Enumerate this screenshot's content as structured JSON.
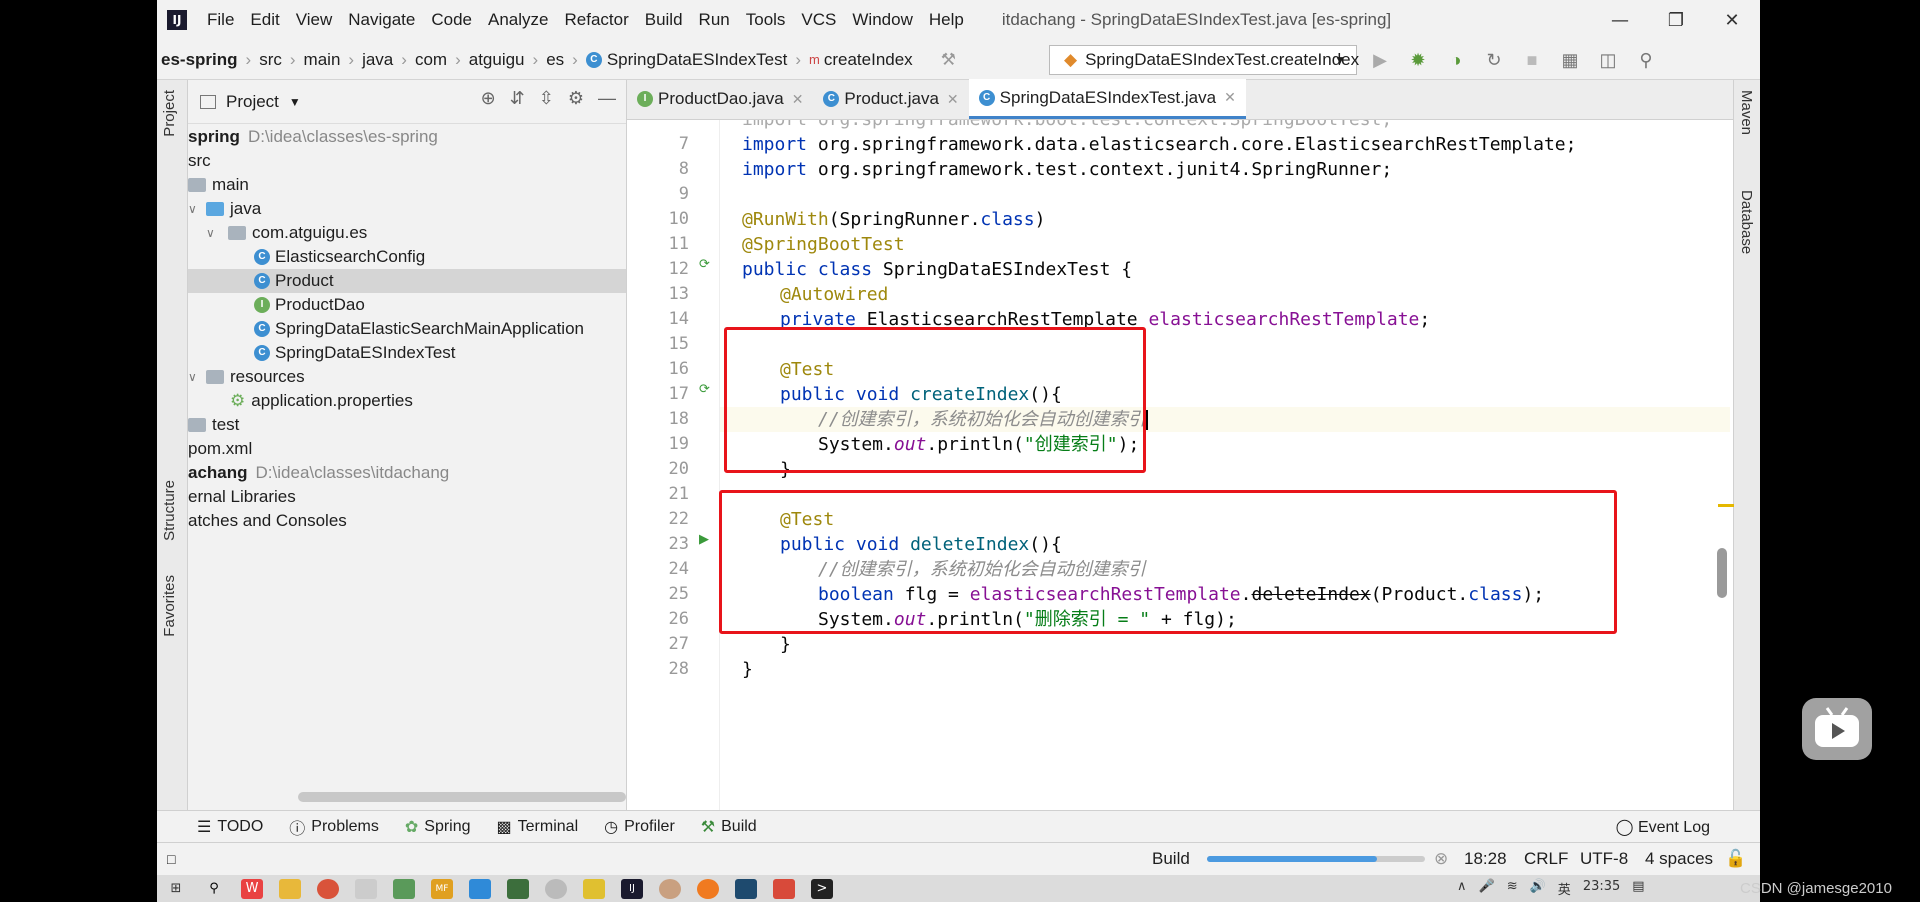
{
  "window": {
    "title": "itdachang - SpringDataESIndexTest.java [es-spring]"
  },
  "menu": [
    "File",
    "Edit",
    "View",
    "Navigate",
    "Code",
    "Analyze",
    "Refactor",
    "Build",
    "Run",
    "Tools",
    "VCS",
    "Window",
    "Help"
  ],
  "breadcrumb": [
    "es-spring",
    "src",
    "main",
    "java",
    "com",
    "atguigu",
    "es",
    "SpringDataESIndexTest",
    "createIndex"
  ],
  "run_config": "SpringDataESIndexTest.createIndex",
  "left_strip": {
    "project": "Project",
    "structure": "Structure",
    "favorites": "Favorites"
  },
  "right_strip": {
    "maven": "Maven",
    "database": "Database"
  },
  "project_panel": {
    "title": "Project",
    "tree": [
      {
        "label": "spring",
        "path": "D:\\idea\\classes\\es-spring"
      },
      {
        "label": "src"
      },
      {
        "label": "main"
      },
      {
        "label": "java"
      },
      {
        "label": "com.atguigu.es"
      },
      {
        "label": "ElasticsearchConfig"
      },
      {
        "label": "Product"
      },
      {
        "label": "ProductDao"
      },
      {
        "label": "SpringDataElasticSearchMainApplication"
      },
      {
        "label": "SpringDataESIndexTest"
      },
      {
        "label": "resources"
      },
      {
        "label": "application.properties"
      },
      {
        "label": "test"
      },
      {
        "label": "pom.xml"
      },
      {
        "label": "achang",
        "path": "D:\\idea\\classes\\itdachang"
      },
      {
        "label": "ernal Libraries"
      },
      {
        "label": "atches and Consoles"
      }
    ]
  },
  "tabs": [
    "ProductDao.java",
    "Product.java",
    "SpringDataESIndexTest.java"
  ],
  "line_numbers": [
    "7",
    "8",
    "9",
    "10",
    "11",
    "12",
    "13",
    "14",
    "15",
    "16",
    "17",
    "18",
    "19",
    "20",
    "21",
    "22",
    "23",
    "24",
    "25",
    "26",
    "27",
    "28"
  ],
  "code": {
    "l6": "import org.springframework.boot.test.context.SpringBootTest;",
    "l7a": "import",
    "l7b": " org.springframework.data.elasticsearch.core.ElasticsearchRestTemplate;",
    "l8a": "import",
    "l8b": " org.springframework.test.context.junit4.SpringRunner;",
    "l10a": "@RunWith",
    "l10b": "(SpringRunner.",
    "l10c": "class",
    "l10d": ")",
    "l11": "@SpringBootTest",
    "l12a": "public class",
    "l12b": " SpringDataESIndexTest {",
    "l13": "@Autowired",
    "l14a": "private",
    "l14b": " ElasticsearchRestTemplate ",
    "l14c": "elasticsearchRestTemplate",
    "l14d": ";",
    "l16": "@Test",
    "l17a": "public void",
    "l17b": "createIndex",
    "l17c": "(){",
    "l18": "//创建索引，系统初始化会自动创建索引",
    "l19a": "System.",
    "l19b": "out",
    "l19c": ".println(",
    "l19d": "\"创建索引\"",
    "l19e": ");",
    "l20": "}",
    "l22": "@Test",
    "l23a": "public void",
    "l23b": "deleteIndex",
    "l23c": "(){",
    "l24": "//创建索引，系统初始化会自动创建索引",
    "l25a": "boolean",
    "l25b": " flg = ",
    "l25c": "elasticsearchRestTemplate",
    "l25d": ".",
    "l25e": "deleteIndex",
    "l25f": "(Product.",
    "l25g": "class",
    "l25h": ");",
    "l26a": "System.",
    "l26b": "out",
    "l26c": ".println(",
    "l26d": "\"删除索引 = \"",
    "l26e": " + flg);",
    "l27": "}",
    "l28": "}"
  },
  "warning_count": "1",
  "bottom_tabs": [
    "TODO",
    "Problems",
    "Spring",
    "Terminal",
    "Profiler",
    "Build"
  ],
  "event_log": "Event Log",
  "status": {
    "build": "Build",
    "position": "18:28",
    "line_sep": "CRLF",
    "encoding": "UTF-8",
    "indent": "4 spaces",
    "build_progress": 0.78
  },
  "taskbar": {
    "time": "23:35",
    "ime": "英"
  },
  "watermark": "CSDN @jamesge2010",
  "colors": {
    "highlight_box": "#e8141a",
    "accent": "#4083c9"
  }
}
